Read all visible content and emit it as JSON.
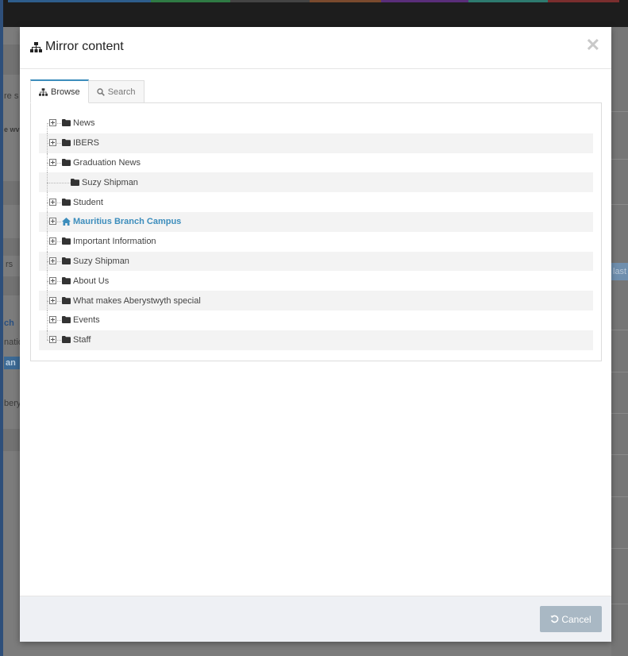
{
  "background": {
    "fragments": [
      "re s",
      "e wv",
      "rs",
      "ch",
      "natio",
      "an",
      "bery",
      "last"
    ]
  },
  "modal": {
    "title": "Mirror content",
    "close_symbol": "✕",
    "tabs": [
      {
        "label": "Browse",
        "icon": "sitemap-icon",
        "active": true
      },
      {
        "label": "Search",
        "icon": "search-icon",
        "active": false
      }
    ],
    "tree": [
      {
        "label": "News",
        "expandable": true,
        "icon": "folder-icon"
      },
      {
        "label": "IBERS",
        "expandable": true,
        "icon": "folder-icon"
      },
      {
        "label": "Graduation News",
        "expandable": true,
        "icon": "folder-icon"
      },
      {
        "label": "Suzy Shipman",
        "expandable": false,
        "icon": "folder-icon"
      },
      {
        "label": "Student",
        "expandable": true,
        "icon": "folder-icon"
      },
      {
        "label": "Mauritius Branch Campus",
        "expandable": true,
        "icon": "home-icon",
        "active": true
      },
      {
        "label": "Important Information",
        "expandable": true,
        "icon": "folder-icon"
      },
      {
        "label": "Suzy Shipman",
        "expandable": true,
        "icon": "folder-icon"
      },
      {
        "label": "About Us",
        "expandable": true,
        "icon": "folder-icon"
      },
      {
        "label": "What makes Aberystwyth special",
        "expandable": true,
        "icon": "folder-icon"
      },
      {
        "label": "Events",
        "expandable": true,
        "icon": "folder-icon"
      },
      {
        "label": "Staff",
        "expandable": true,
        "icon": "folder-icon"
      }
    ],
    "footer": {
      "cancel_label": "Cancel",
      "cancel_icon": "undo-icon"
    }
  },
  "colors": {
    "accent": "#3c8dbc",
    "cancel_button": "#a9b8c4",
    "footer_bg": "#eef0f4",
    "overlay": "#7c7c7c"
  }
}
